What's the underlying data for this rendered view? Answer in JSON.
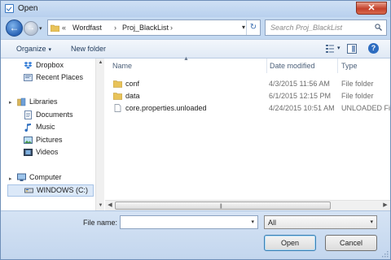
{
  "window": {
    "title": "Open",
    "close_glyph": "✕"
  },
  "address": {
    "prefix": "«",
    "crumbs": [
      "Wordfast",
      "Proj_BlackList"
    ],
    "separator": "›"
  },
  "search": {
    "placeholder": "Search Proj_BlackList"
  },
  "toolbar": {
    "organize_label": "Organize",
    "new_folder_label": "New folder"
  },
  "nav": {
    "favorites": [
      {
        "label": "Dropbox",
        "icon": "dropbox-icon"
      },
      {
        "label": "Recent Places",
        "icon": "recent-places-icon"
      }
    ],
    "libraries_label": "Libraries",
    "libraries": [
      {
        "label": "Documents",
        "icon": "documents-icon"
      },
      {
        "label": "Music",
        "icon": "music-icon"
      },
      {
        "label": "Pictures",
        "icon": "pictures-icon"
      },
      {
        "label": "Videos",
        "icon": "videos-icon"
      }
    ],
    "computer_label": "Computer",
    "drives": [
      {
        "label": "WINDOWS (C:)",
        "icon": "drive-icon",
        "selected": true
      }
    ]
  },
  "columns": {
    "name": "Name",
    "date": "Date modified",
    "type": "Type"
  },
  "files": [
    {
      "name": "conf",
      "date": "4/3/2015 11:56 AM",
      "type": "File folder",
      "icon": "folder-icon"
    },
    {
      "name": "data",
      "date": "6/1/2015 12:15 PM",
      "type": "File folder",
      "icon": "folder-icon"
    },
    {
      "name": "core.properties.unloaded",
      "date": "4/24/2015 10:51 AM",
      "type": "UNLOADED Fi",
      "icon": "file-icon"
    }
  ],
  "bottom": {
    "filename_label": "File name:",
    "filename_value": "",
    "filter_value": "All",
    "open_label": "Open",
    "cancel_label": "Cancel"
  },
  "colors": {
    "accent": "#2a64b6",
    "frame": "#c4d9f1",
    "folder": "#e8c35a"
  }
}
